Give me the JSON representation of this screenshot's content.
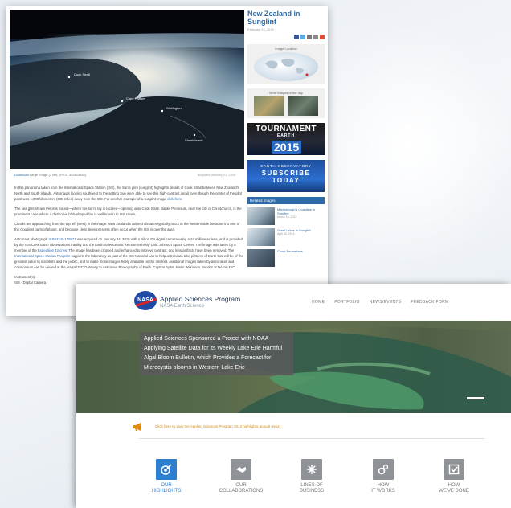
{
  "earth_observatory": {
    "photo_place_labels": [
      "Cook Strait",
      "Cape Palliser",
      "Wellington",
      "Christchurch"
    ],
    "caption_link": "Download",
    "caption_text": "Large Image (2 MB, JPEG, 4928x3280)",
    "caption_date": "acquired January 21, 2015",
    "article_p1_before": "In this panorama taken from the International Space Station (ISS), the Sun's glint (sunglint) highlights details of Cook Strait between New Zealand's North and South Islands. Astronauts looking southwest to the setting Sun were able to see this high-contrast detail even though the center of the glint point was 1,000 kilometers (600 miles) away from the ISS. For another example of a sunglint image",
    "article_p1_link": "click here.",
    "article_p2": "The sea glint shows Pelorus Sound—where the sun's ray is located—opening onto Cook Strait. Banks Peninsula, near the city of Christchurch, is the prominent cape where a distinctive blob-shaped fan is well known to ISS crews.",
    "article_p3": "Clouds are approaching from the top left (west) in the image. New Zealand's rainiest climates typically occur in the western side because it is one of the cloudiest parts of planet, and because clear skies presents often occur when the ISS is over the area.",
    "article_p4_a": "Astronaut photograph",
    "article_p4_link": "ISS042-E-179871",
    "article_p4_b": "was acquired on January 24, 2015 with a Nikon D4 digital camera using a 24 millimeter lens, and is provided by the ISS Crew Earth Observations Facility and the Earth Science and Remote Sensing Unit, Johnson Space Center. The image was taken by a member of the",
    "article_p4_link2": "Expedition 42 crew",
    "article_p4_c": ". The image has been cropped and enhanced to improve contrast, and lens artifacts have been removed. The",
    "article_p4_link3": "International Space Station Program",
    "article_p4_d": "supports the laboratory as part of the ISS National Lab to help astronauts take pictures of Earth that will be of the greatest value to scientists and the public, and to make those images freely available on the Internet. Additional images taken by astronauts and cosmonauts can be viewed at the NASA/JSC Gateway to Astronaut Photography of Earth. Caption by M. Justin Wilkinson, Jacobs at NASA-JSC.",
    "byline_1": "Instrument(s):",
    "byline_2": "ISS - Digital Camera",
    "side_title": "New Zealand in Sunglint",
    "side_date": "February 23, 2015",
    "image_location_label": "Image Location",
    "more_images_label": "More images of the day",
    "tournament_line1": "TOURNAMENT",
    "tournament_line2": "EARTH",
    "tournament_year": "2015",
    "subscribe_line1": "EARTH OBSERVATORY",
    "subscribe_line2": "SUBSCRIBE",
    "subscribe_line3": "TODAY",
    "related_header": "Related Images",
    "related": [
      {
        "title": "Marlborough's Coastline in Sunglint",
        "date": "March 16, 2013"
      },
      {
        "title": "Great Lakes in Sunglint",
        "date": "April 26, 2014"
      },
      {
        "title": "Cloud Formations",
        "date": ""
      }
    ]
  },
  "applied_sciences": {
    "logo_text": "NASA",
    "program_title": "Applied Sciences Program",
    "program_subtitle": "NASA Earth Science",
    "nav": [
      "HOME",
      "PORTFOLIO",
      "NEWS/EVENTS",
      "FEEDBACK FORM"
    ],
    "hero_text": "Applied Sciences Sponsored a Project with NOAA Applying Satellite Data for its Weekly Lake Erie Harmful Algal Bloom Bulletin, which Provides a Forecast for Microcystis blooms in Western Lake Erie",
    "notice_text": "Click here to view the Applied Sciences Program 2014 highlights annual report",
    "tiles": [
      {
        "line1": "OUR",
        "line2": "HIGHLIGHTS",
        "icon": "target-icon"
      },
      {
        "line1": "OUR",
        "line2": "COLLABORATIONS",
        "icon": "handshake-icon"
      },
      {
        "line1": "LINES OF",
        "line2": "BUSINESS",
        "icon": "asterisk-icon"
      },
      {
        "line1": "HOW",
        "line2": "IT WORKS",
        "icon": "gears-icon"
      },
      {
        "line1": "HOW",
        "line2": "WE'VE DONE",
        "icon": "checkbox-icon"
      }
    ]
  },
  "colors": {
    "accent_blue": "#2f7fd1",
    "eo_title_blue": "#2d6aa8",
    "notice_orange": "#d08a17",
    "nasa_blue": "#1f4aa5",
    "nasa_red": "#dd2222"
  }
}
